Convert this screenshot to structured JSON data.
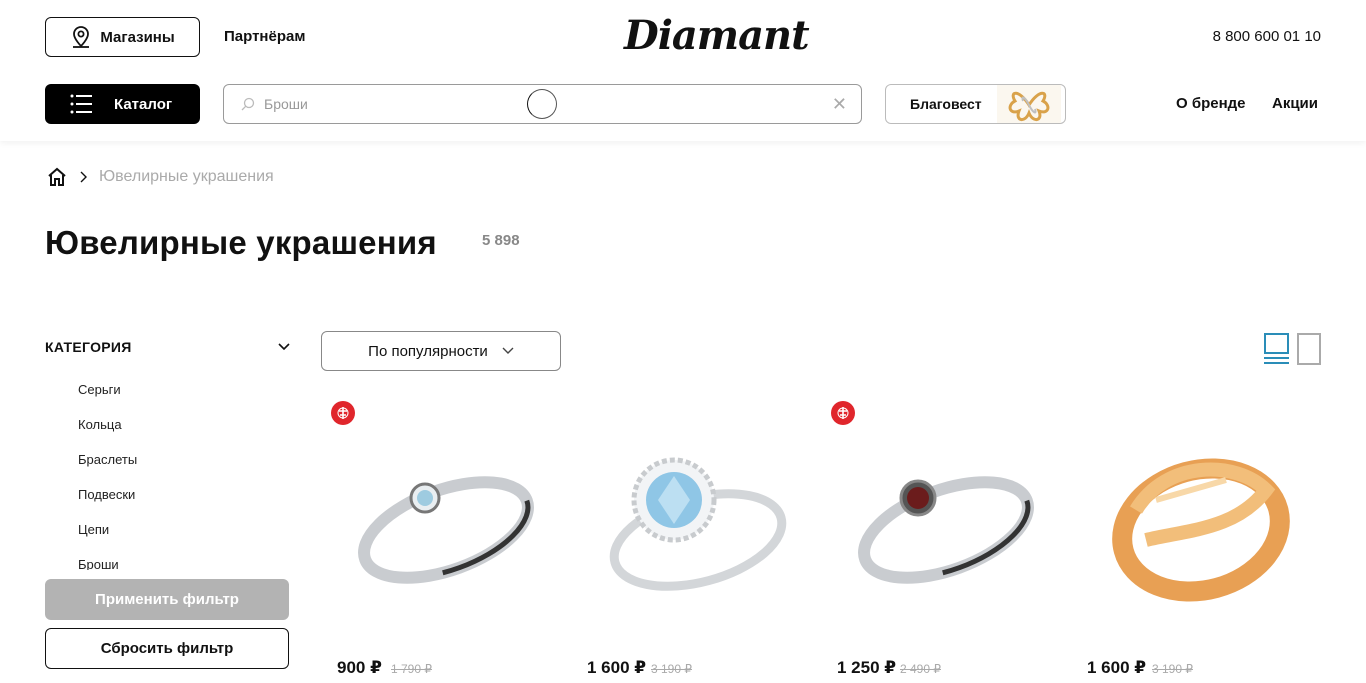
{
  "header": {
    "stores_label": "Магазины",
    "partners_label": "Партнёрам",
    "logo_text": "Diamant",
    "phone": "8 800 600 01 10",
    "catalog_label": "Каталог",
    "search_placeholder": "Броши",
    "promo_label": "Благовест",
    "about_label": "О бренде",
    "sales_label": "Акции"
  },
  "breadcrumb": {
    "current": "Ювелирные украшения"
  },
  "page": {
    "title": "Ювелирные украшения",
    "count": "5 898"
  },
  "filter": {
    "category_title": "КАТЕГОРИЯ",
    "categories": [
      "Серьги",
      "Кольца",
      "Браслеты",
      "Подвески",
      "Цепи",
      "Броши"
    ],
    "apply_label": "Применить фильтр",
    "reset_label": "Сбросить фильтр"
  },
  "sort": {
    "selected": "По популярности"
  },
  "products": [
    {
      "price": "900 ₽",
      "old_price": "1 790 ₽",
      "badge": true,
      "image": "silver-ring-blue-stone"
    },
    {
      "price": "1 600 ₽",
      "old_price": "3 190 ₽",
      "badge": false,
      "image": "silver-ring-topaz-halo"
    },
    {
      "price": "1 250 ₽",
      "old_price": "2 490 ₽",
      "badge": true,
      "image": "silver-ring-garnet"
    },
    {
      "price": "1 600 ₽",
      "old_price": "3 190 ₽",
      "badge": false,
      "image": "gold-ring-infinity"
    }
  ],
  "colors": {
    "accent": "#000000",
    "badge": "#e0262c",
    "disabled": "#b3b3b3",
    "view_active": "#2a8db8"
  }
}
